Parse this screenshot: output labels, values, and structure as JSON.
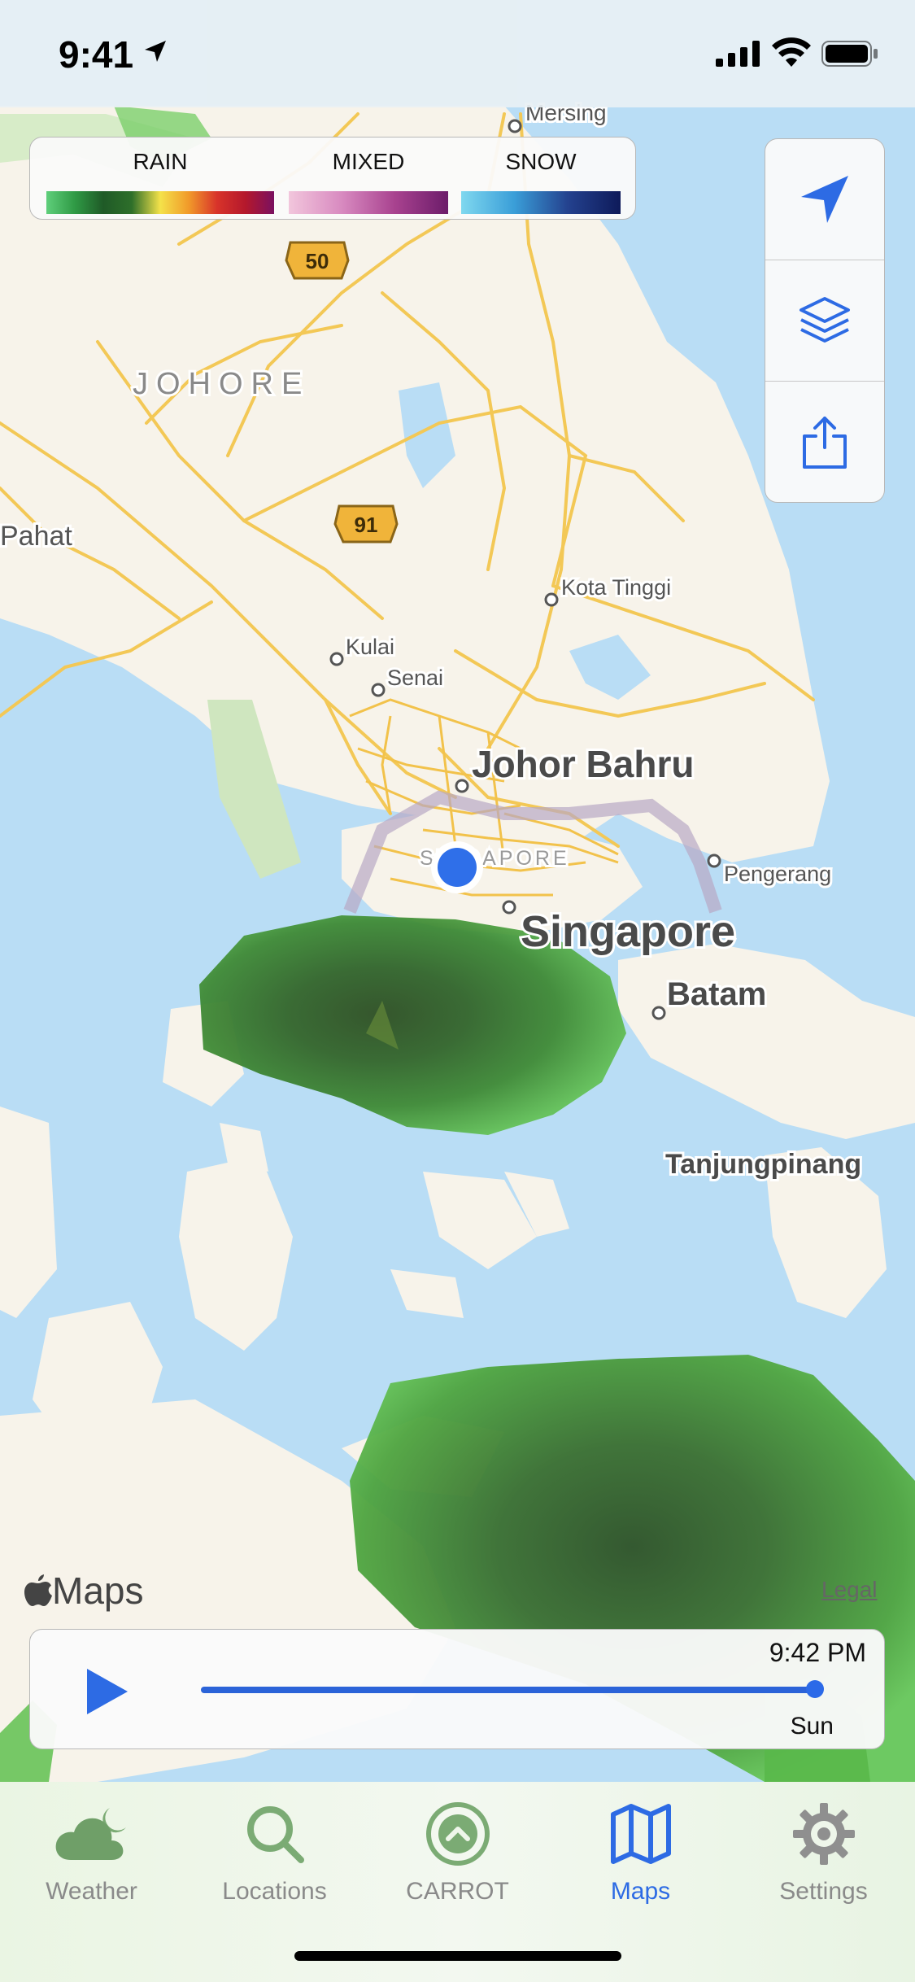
{
  "status": {
    "time": "9:41"
  },
  "legend": {
    "rain": "RAIN",
    "mixed": "MIXED",
    "snow": "SNOW"
  },
  "map": {
    "labels": [
      "Mersing",
      "JOHORE",
      "Pahat",
      "Kota Tinggi",
      "Kulai",
      "Senai",
      "Johor Bahru",
      "SINGAPORE",
      "Singapore",
      "Pengerang",
      "Batam",
      "Tanjungpinang"
    ],
    "route_shields": [
      "50",
      "91"
    ],
    "brand": "Maps",
    "legal": "Legal"
  },
  "player": {
    "time": "9:42 PM",
    "day": "Sun",
    "progress": 1.0
  },
  "tabs": [
    {
      "label": "Weather",
      "icon": "cloud-moon-icon"
    },
    {
      "label": "Locations",
      "icon": "search-icon"
    },
    {
      "label": "CARROT",
      "icon": "carrot-chevron-icon"
    },
    {
      "label": "Maps",
      "icon": "map-icon",
      "active": true
    },
    {
      "label": "Settings",
      "icon": "gear-icon"
    }
  ],
  "colors": {
    "accent": "#2d6be4",
    "water": "#b9ddf5",
    "land": "#f7f3ea",
    "road": "#f3c856",
    "rain": "#2f7a2c"
  }
}
